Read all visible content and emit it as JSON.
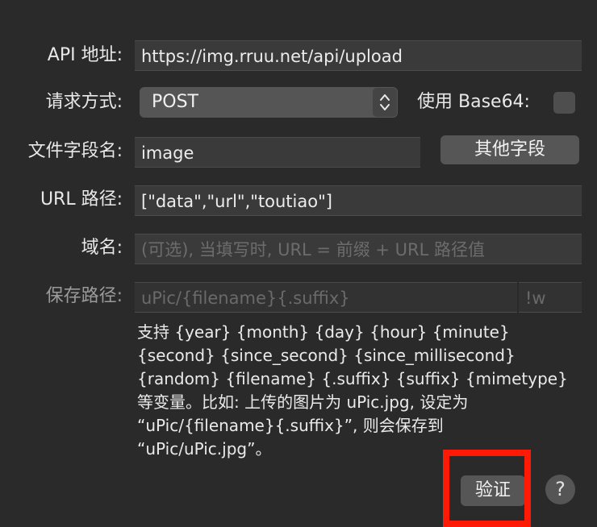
{
  "form": {
    "api_label": "API 地址:",
    "api_value": "https://img.rruu.net/api/upload",
    "method_label": "请求方式:",
    "method_value": "POST",
    "base64_label": "使用 Base64:",
    "base64_checked": false,
    "file_field_label": "文件字段名:",
    "file_field_value": "image",
    "other_fields_button": "其他字段",
    "url_path_label": "URL 路径:",
    "url_path_value": "[\"data\",\"url\",\"toutiao\"]",
    "domain_label": "域名:",
    "domain_placeholder": "(可选), 当填写时, URL = 前缀 + URL 路径值",
    "save_path_label": "保存路径:",
    "save_path_placeholder": "uPic/{filename}{.suffix}",
    "save_path_suffix_placeholder": "!w",
    "description": "支持 {year} {month} {day} {hour} {minute} {second} {since_second} {since_millisecond} {random} {filename} {.suffix} {suffix} {mimetype} 等变量。比如: 上传的图片为 uPic.jpg, 设定为 “uPic/{filename}{.suffix}”, 则会保存到 “uPic/uPic.jpg”。",
    "verify_button": "验证",
    "help_button": "?"
  },
  "colors": {
    "background": "#2a2a2a",
    "field": "#3a3a3a",
    "button": "#565656",
    "highlight": "#ff1a05"
  }
}
